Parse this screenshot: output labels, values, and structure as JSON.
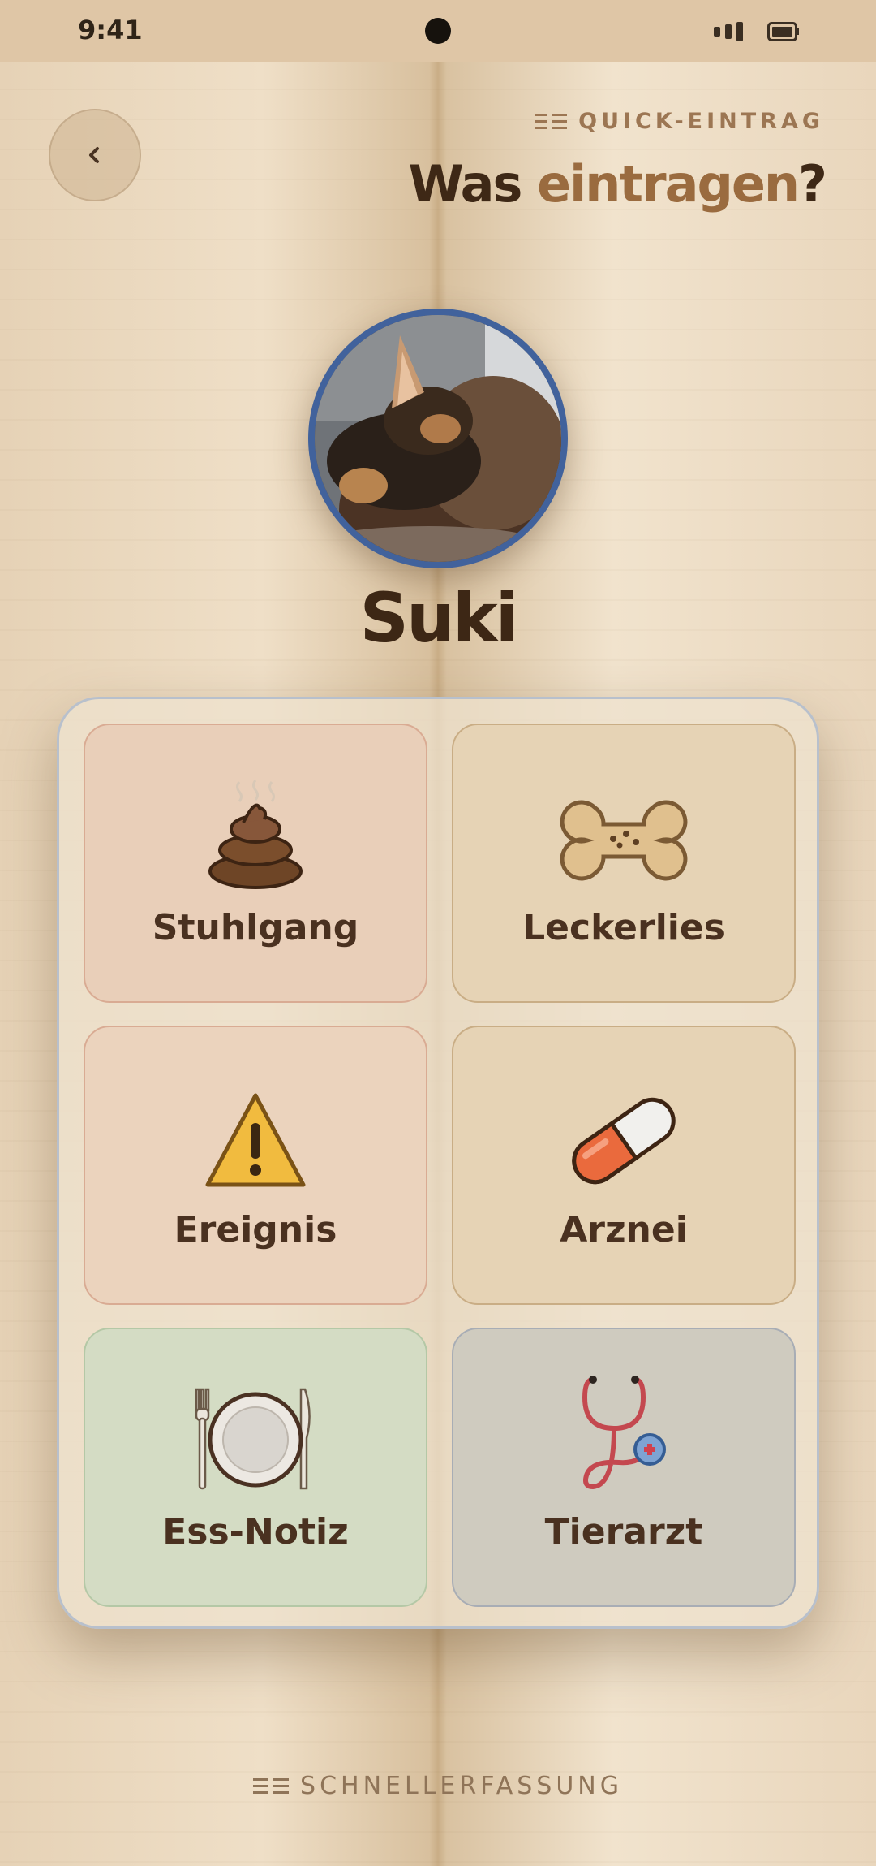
{
  "status_bar": {
    "time": "9:41"
  },
  "header": {
    "back_icon": "chevron-left-icon",
    "eyebrow": "QUICK-EINTRAG",
    "eyebrow_icon": "list-icon",
    "title_part1": "Was",
    "title_part2": "eintragen",
    "title_part3": "?"
  },
  "pet": {
    "name": "Suki",
    "avatar": "photo of sleeping dogs"
  },
  "entries": [
    {
      "label": "Stuhlgang",
      "icon": "poop-icon",
      "color": "#e9cfb9"
    },
    {
      "label": "Leckerlies",
      "icon": "bone-icon",
      "color": "#e6d3b5"
    },
    {
      "label": "Ereignis",
      "icon": "warning-icon",
      "color": "#ebd3bd"
    },
    {
      "label": "Arznei",
      "icon": "pill-icon",
      "color": "#e6d3b5"
    },
    {
      "label": "Ess-Notiz",
      "icon": "plate-icon",
      "color": "#d4dcc4"
    },
    {
      "label": "Tierarzt",
      "icon": "stethoscope-icon",
      "color": "#cfcbbf"
    }
  ],
  "footer": {
    "label": "SCHNELLERFASSUNG",
    "icon": "list-icon"
  },
  "colors": {
    "accent": "#9a6b3f",
    "avatar_ring": "#41629c",
    "text": "#3e2816"
  }
}
